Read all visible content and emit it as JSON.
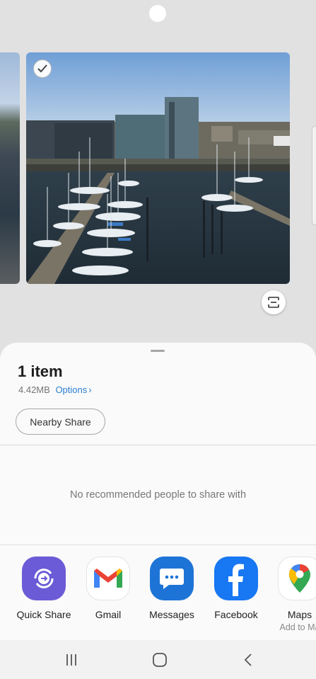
{
  "preview": {
    "selected": true,
    "main_photo": "harbor-marina-photo"
  },
  "sheet": {
    "item_count": "1 item",
    "file_size": "4.42MB",
    "options_label": "Options",
    "nearby_share_label": "Nearby Share",
    "no_people_text": "No recommended people to share with"
  },
  "apps": [
    {
      "label": "Quick Share",
      "icon": "quick-share-icon",
      "color": "#6b5bd6"
    },
    {
      "label": "Gmail",
      "icon": "gmail-icon",
      "color": "#ea4335"
    },
    {
      "label": "Messages",
      "icon": "messages-icon",
      "color": "#1e74d6"
    },
    {
      "label": "Facebook",
      "icon": "facebook-icon",
      "color": "#1877f2"
    },
    {
      "label": "Maps",
      "sublabel": "Add to Ma",
      "icon": "maps-icon",
      "color": "#34a853"
    }
  ],
  "navbar": {
    "recents_icon": "recents-icon",
    "home_icon": "home-icon",
    "back_icon": "back-icon"
  }
}
